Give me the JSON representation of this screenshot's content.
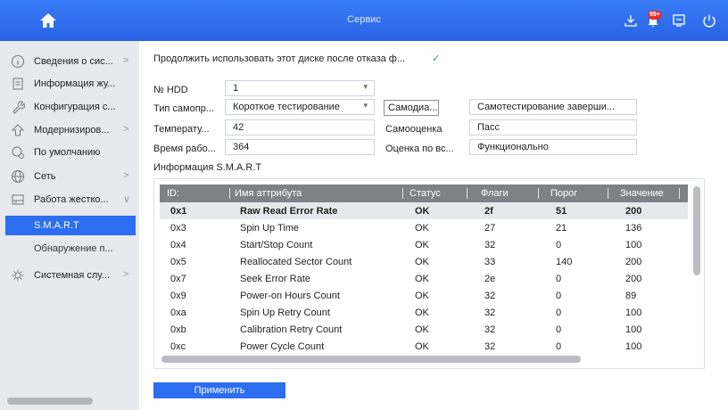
{
  "header": {
    "title": "Сервис",
    "alarm_badge": "99+",
    "accent": "#2d6df0"
  },
  "sidebar": {
    "items": [
      {
        "label": "Сведения о сис...",
        "icon": "info-icon",
        "arrow": ">"
      },
      {
        "label": "Информация жу...",
        "icon": "log-icon",
        "arrow": ""
      },
      {
        "label": "Конфигурация с...",
        "icon": "wrench-icon",
        "arrow": ""
      },
      {
        "label": "Модернизиров...",
        "icon": "upgrade-icon",
        "arrow": ">"
      },
      {
        "label": "По умолчанию",
        "icon": "default-icon",
        "arrow": ""
      },
      {
        "label": "Сеть",
        "icon": "network-icon",
        "arrow": ">"
      },
      {
        "label": "Работа жестко...",
        "icon": "hdd-icon",
        "arrow": "∨"
      },
      {
        "label": "Системная слу...",
        "icon": "service-icon",
        "arrow": ">"
      }
    ],
    "subitems": [
      {
        "label": "S.M.A.R.T",
        "active": true
      },
      {
        "label": "Обнаружение п...",
        "active": false
      }
    ]
  },
  "form": {
    "continue_label": "Продолжить использовать этот диске после отказа ф...",
    "hdd_label": "№ HDD",
    "hdd_value": "1",
    "selftest_type_label": "Тип самопр...",
    "selftest_type_value": "Короткое тестирование",
    "selftest_button": "Самодиа...",
    "selftest_status": "Самотестирование заверши...",
    "temp_label": "Температу...",
    "temp_value": "42",
    "selfeval_label": "Самооценка",
    "selfeval_value": "Пасс",
    "uptime_label": "Время рабо...",
    "uptime_value": "364",
    "overall_label": "Оценка по вс...",
    "overall_value": "Функционально",
    "smart_info_label": "Информация S.M.A.R.T"
  },
  "table": {
    "headers": [
      "ID:",
      "Имя аттрибута",
      "Статус",
      "Флаги",
      "Порог",
      "Значение"
    ],
    "rows": [
      [
        "0x1",
        "Raw Read Error Rate",
        "OK",
        "2f",
        "51",
        "200"
      ],
      [
        "0x3",
        "Spin Up Time",
        "OK",
        "27",
        "21",
        "136"
      ],
      [
        "0x4",
        "Start/Stop Count",
        "OK",
        "32",
        "0",
        "100"
      ],
      [
        "0x5",
        "Reallocated Sector Count",
        "OK",
        "33",
        "140",
        "200"
      ],
      [
        "0x7",
        "Seek Error Rate",
        "OK",
        "2e",
        "0",
        "200"
      ],
      [
        "0x9",
        "Power-on Hours Count",
        "OK",
        "32",
        "0",
        "89"
      ],
      [
        "0xa",
        "Spin Up Retry Count",
        "OK",
        "32",
        "0",
        "100"
      ],
      [
        "0xb",
        "Calibration Retry Count",
        "OK",
        "32",
        "0",
        "100"
      ],
      [
        "0xc",
        "Power Cycle Count",
        "OK",
        "32",
        "0",
        "100"
      ]
    ]
  },
  "actions": {
    "apply_label": "Применить"
  }
}
